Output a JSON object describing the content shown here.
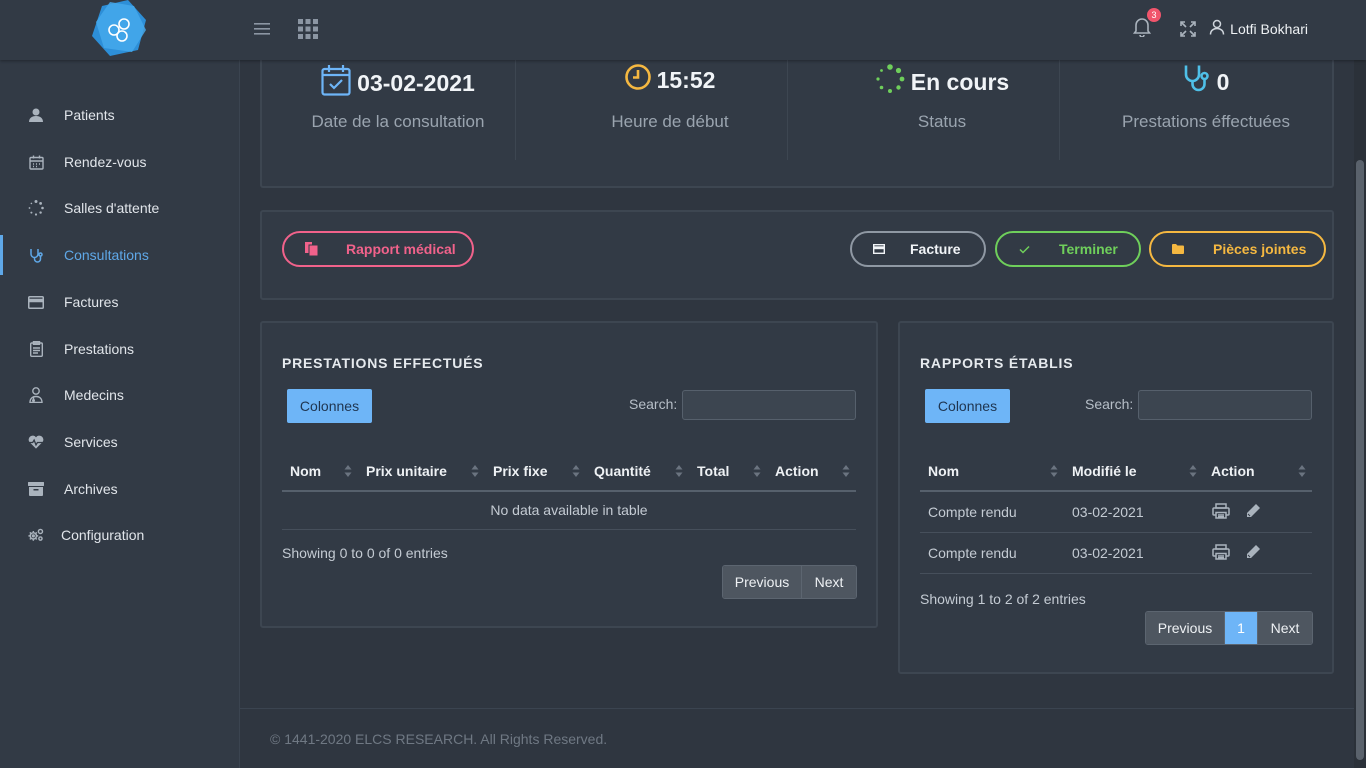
{
  "header": {
    "notification_count": "3",
    "user_name": "Lotfi Bokhari"
  },
  "sidebar": {
    "items": [
      {
        "label": "Patients",
        "icon": "user-icon"
      },
      {
        "label": "Rendez-vous",
        "icon": "calendar-icon"
      },
      {
        "label": "Salles d'attente",
        "icon": "spinner-icon"
      },
      {
        "label": "Consultations",
        "icon": "stethoscope-icon"
      },
      {
        "label": "Factures",
        "icon": "credit-card-icon"
      },
      {
        "label": "Prestations",
        "icon": "clipboard-icon"
      },
      {
        "label": "Medecins",
        "icon": "doctor-icon"
      },
      {
        "label": "Services",
        "icon": "heartbeat-icon"
      },
      {
        "label": "Archives",
        "icon": "archive-icon"
      },
      {
        "label": "Configuration",
        "icon": "cogs-icon"
      }
    ],
    "active": "Consultations"
  },
  "stats": [
    {
      "value": "03-02-2021",
      "label": "Date de la consultation",
      "icon": "calendar-check-icon",
      "color": "#6eb5f7"
    },
    {
      "value": "15:52",
      "label": "Heure de début",
      "icon": "clock-icon",
      "color": "#f5b841"
    },
    {
      "value": "En cours",
      "label": "Status",
      "icon": "spinner-icon",
      "color": "#6fcf5b"
    },
    {
      "value": "0",
      "label": "Prestations éffectuées",
      "icon": "stethoscope-icon",
      "color": "#4fc0e8"
    }
  ],
  "actions": {
    "rapport": "Rapport médical",
    "facture": "Facture",
    "terminer": "Terminer",
    "pieces": "Pièces jointes"
  },
  "colors": {
    "pink": "#f1628b",
    "grey": "#aab3bd",
    "green": "#6fcf5b",
    "yellow": "#f5b841",
    "accent": "#6eb5f7"
  },
  "prestations": {
    "title": "PRESTATIONS EFFECTUÉS",
    "columns_btn": "Colonnes",
    "search_label": "Search:",
    "search_value": "",
    "headers": [
      "Nom",
      "Prix unitaire",
      "Prix fixe",
      "Quantité",
      "Total",
      "Action"
    ],
    "empty": "No data available in table",
    "info": "Showing 0 to 0 of 0 entries",
    "prev": "Previous",
    "next": "Next"
  },
  "rapports": {
    "title": "RAPPORTS ÉTABLIS",
    "columns_btn": "Colonnes",
    "search_label": "Search:",
    "search_value": "",
    "headers": [
      "Nom",
      "Modifié le",
      "Action"
    ],
    "rows": [
      {
        "nom": "Compte rendu",
        "date": "03-02-2021"
      },
      {
        "nom": "Compte rendu",
        "date": "03-02-2021"
      }
    ],
    "info": "Showing 1 to 2 of 2 entries",
    "prev": "Previous",
    "page": "1",
    "next": "Next"
  },
  "footer": "© 1441-2020 ELCS RESEARCH. All Rights Reserved."
}
